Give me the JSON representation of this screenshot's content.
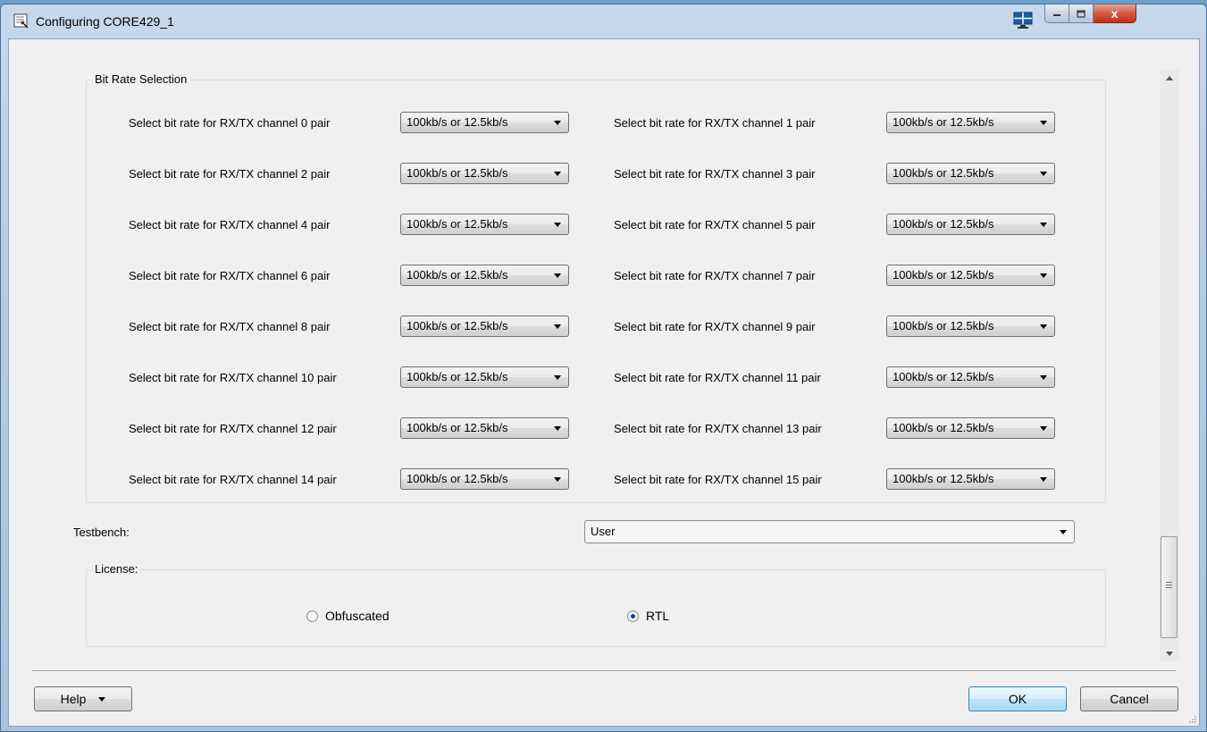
{
  "window": {
    "title": "Configuring CORE429_1",
    "close_glyph": "x"
  },
  "bit_rate_group": {
    "label": "Bit Rate Selection",
    "rows": [
      {
        "left_label": "Select bit rate for RX/TX channel 0 pair",
        "left_value": "100kb/s or 12.5kb/s",
        "right_label": "Select bit rate for RX/TX channel 1 pair",
        "right_value": "100kb/s or 12.5kb/s"
      },
      {
        "left_label": "Select bit rate for RX/TX channel 2 pair",
        "left_value": "100kb/s or 12.5kb/s",
        "right_label": "Select bit rate for RX/TX channel 3 pair",
        "right_value": "100kb/s or 12.5kb/s"
      },
      {
        "left_label": "Select bit rate for RX/TX channel 4 pair",
        "left_value": "100kb/s or 12.5kb/s",
        "right_label": "Select bit rate for RX/TX channel 5 pair",
        "right_value": "100kb/s or 12.5kb/s"
      },
      {
        "left_label": "Select bit rate for RX/TX channel 6 pair",
        "left_value": "100kb/s or 12.5kb/s",
        "right_label": "Select bit rate for RX/TX channel 7 pair",
        "right_value": "100kb/s or 12.5kb/s"
      },
      {
        "left_label": "Select bit rate for RX/TX channel 8 pair",
        "left_value": "100kb/s or 12.5kb/s",
        "right_label": "Select bit rate for RX/TX channel 9 pair",
        "right_value": "100kb/s or 12.5kb/s"
      },
      {
        "left_label": "Select bit rate for RX/TX channel 10 pair",
        "left_value": "100kb/s or 12.5kb/s",
        "right_label": "Select bit rate for RX/TX channel 11 pair",
        "right_value": "100kb/s or 12.5kb/s"
      },
      {
        "left_label": "Select bit rate for RX/TX channel 12 pair",
        "left_value": "100kb/s or 12.5kb/s",
        "right_label": "Select bit rate for RX/TX channel 13 pair",
        "right_value": "100kb/s or 12.5kb/s"
      },
      {
        "left_label": "Select bit rate for RX/TX channel 14 pair",
        "left_value": "100kb/s or 12.5kb/s",
        "right_label": "Select bit rate for RX/TX channel 15 pair",
        "right_value": "100kb/s or 12.5kb/s"
      }
    ]
  },
  "testbench": {
    "label": "Testbench:",
    "value": "User"
  },
  "license": {
    "label": "License:",
    "options": [
      {
        "label": "Obfuscated",
        "checked": false
      },
      {
        "label": "RTL",
        "checked": true
      }
    ]
  },
  "footer": {
    "help_label": "Help",
    "ok_label": "OK",
    "cancel_label": "Cancel"
  },
  "colors": {
    "accent": "#3c7fb1",
    "close_button": "#c4301a",
    "radio_dot": "#1a3f87"
  }
}
